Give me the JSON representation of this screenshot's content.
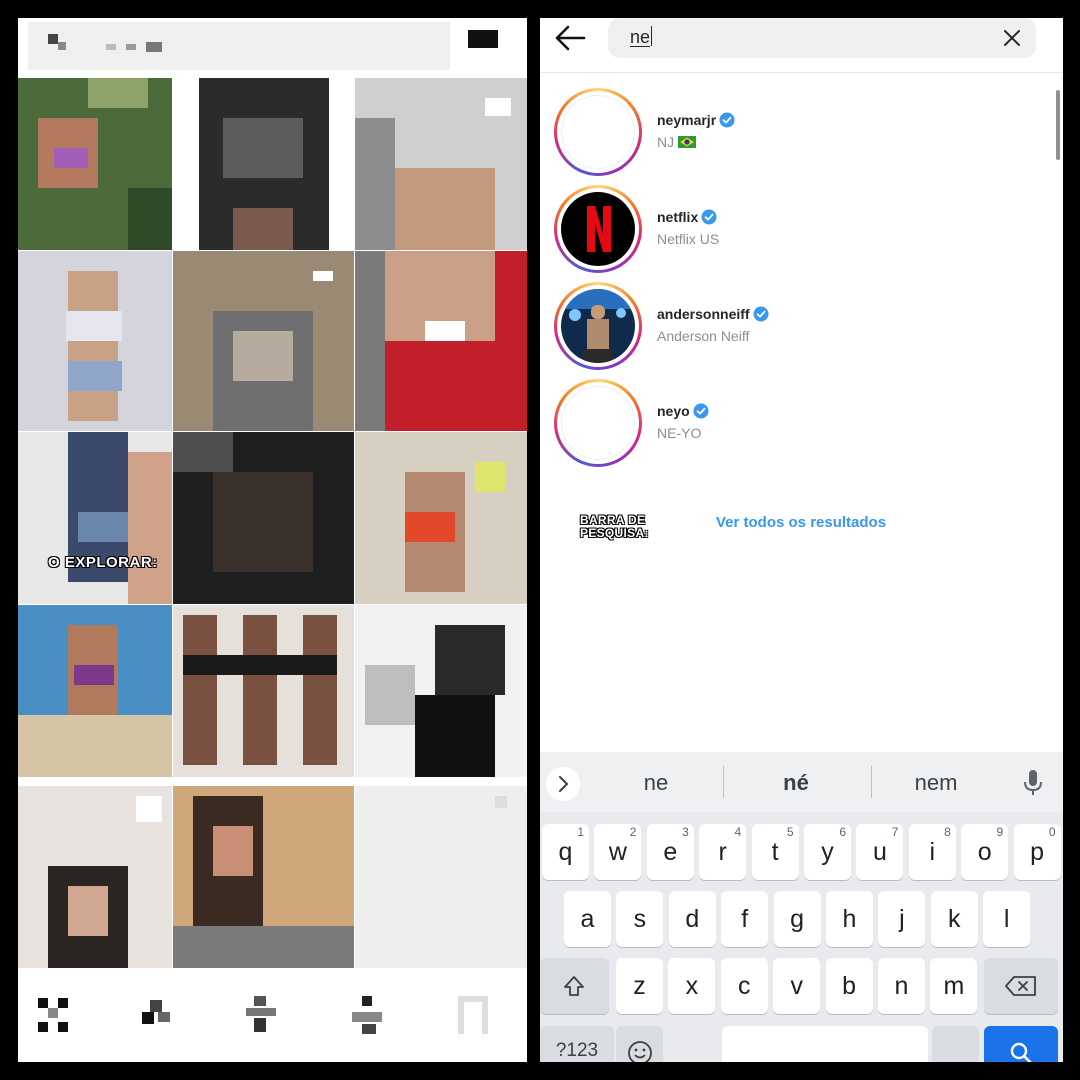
{
  "explore": {
    "caption": "O EXPLORAR:"
  },
  "search": {
    "query": "ne",
    "results": [
      {
        "username": "neymarjr",
        "fullname": "NJ",
        "flag": "brazil-flag",
        "avatar": "blank"
      },
      {
        "username": "netflix",
        "fullname": "Netflix US",
        "avatar": "netflix-logo"
      },
      {
        "username": "andersonneiff",
        "fullname": "Anderson Neiff",
        "avatar": "concert-photo"
      },
      {
        "username": "neyo",
        "fullname": "NE-YO",
        "avatar": "blank"
      }
    ],
    "see_all": "Ver todos os resultados",
    "annotation": "BARRA DE PESQUISA:"
  },
  "keyboard": {
    "suggestions": [
      "ne",
      "né",
      "nem"
    ],
    "row1": [
      {
        "ch": "q",
        "num": "1"
      },
      {
        "ch": "w",
        "num": "2"
      },
      {
        "ch": "e",
        "num": "3"
      },
      {
        "ch": "r",
        "num": "4"
      },
      {
        "ch": "t",
        "num": "5"
      },
      {
        "ch": "y",
        "num": "6"
      },
      {
        "ch": "u",
        "num": "7"
      },
      {
        "ch": "i",
        "num": "8"
      },
      {
        "ch": "o",
        "num": "9"
      },
      {
        "ch": "p",
        "num": "0"
      }
    ],
    "row2": [
      "a",
      "s",
      "d",
      "f",
      "g",
      "h",
      "j",
      "k",
      "l"
    ],
    "row3": [
      "z",
      "x",
      "c",
      "v",
      "b",
      "n",
      "m"
    ],
    "symbols_label": "?123"
  },
  "colors": {
    "verified": "#3897f0",
    "link": "#3897f0",
    "netflix_red": "#e50914",
    "keyboard_search": "#1a73e8"
  }
}
